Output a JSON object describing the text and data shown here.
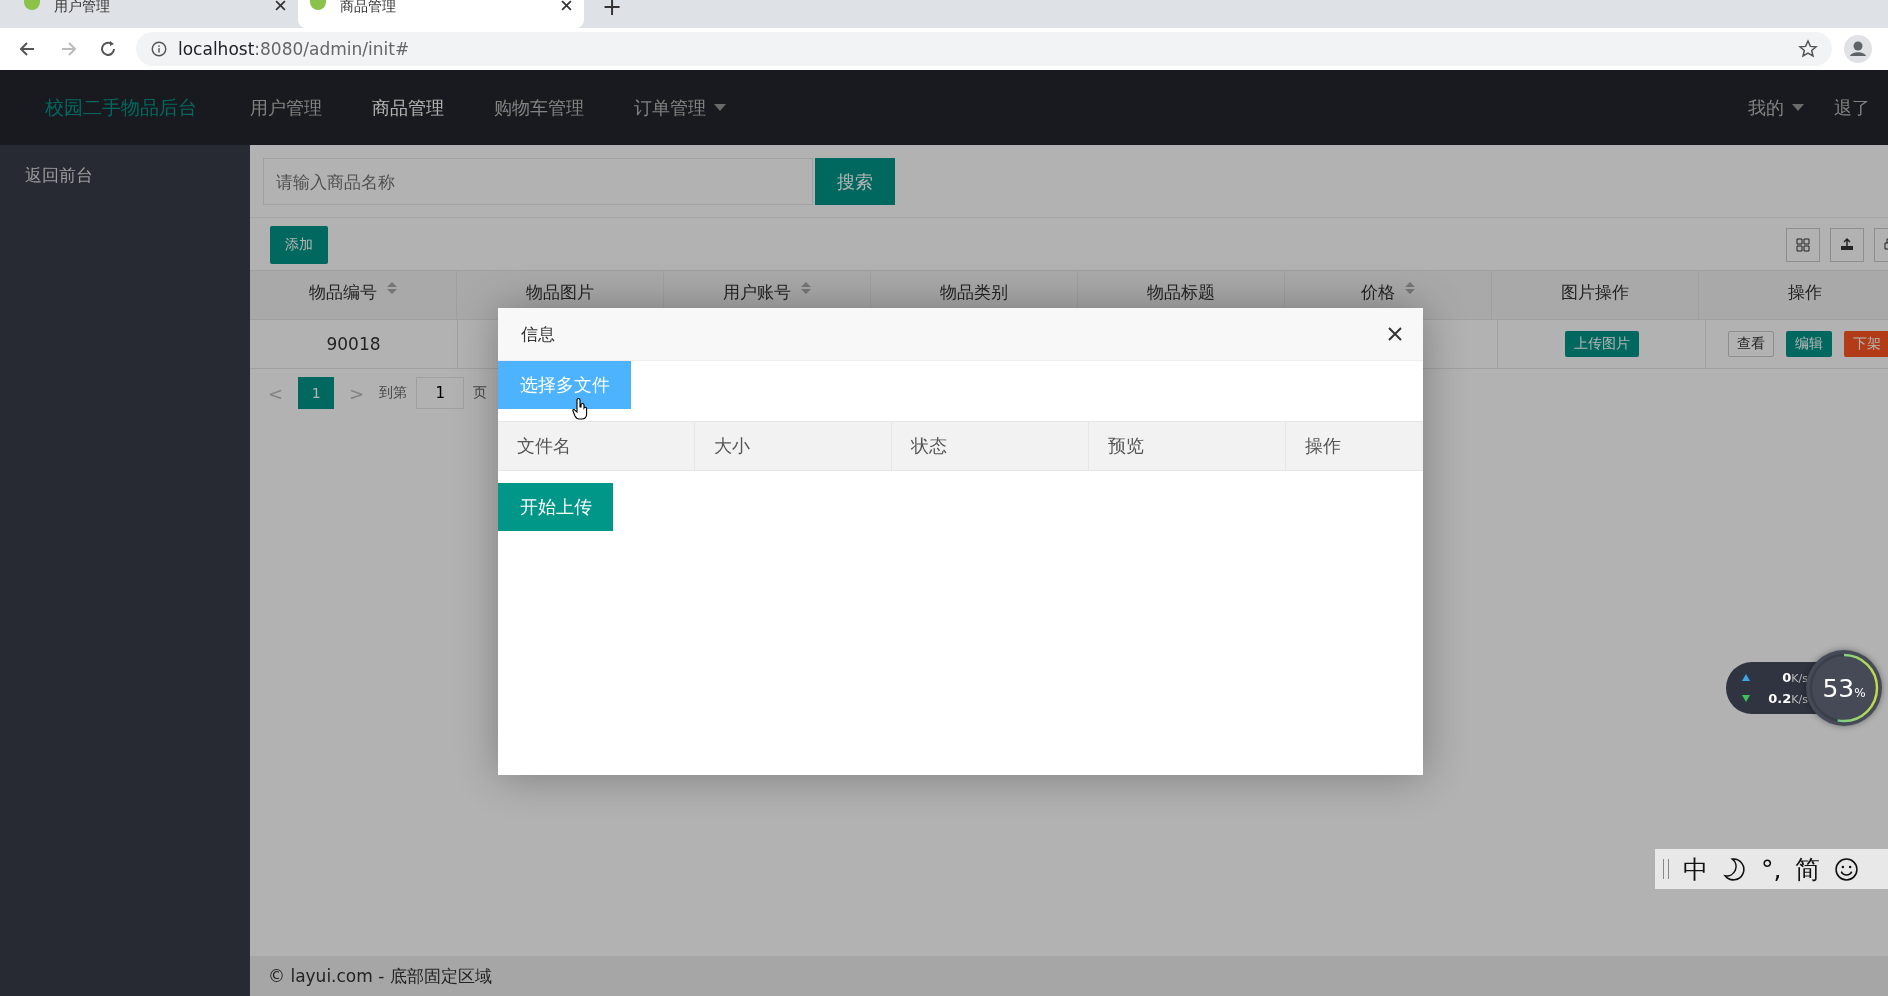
{
  "browser": {
    "tabs": [
      {
        "title": "用户管理",
        "selected": false
      },
      {
        "title": "商品管理",
        "selected": true
      }
    ],
    "new_tab": "+",
    "url_host": "localhost",
    "url_rest": ":8080/admin/init#"
  },
  "nav": {
    "logo": "校园二手物品后台",
    "items": [
      {
        "label": "用户管理",
        "selected": false,
        "dropdown": false
      },
      {
        "label": "商品管理",
        "selected": true,
        "dropdown": false
      },
      {
        "label": "购物车管理",
        "selected": false,
        "dropdown": false
      },
      {
        "label": "订单管理",
        "selected": false,
        "dropdown": true
      }
    ],
    "right": [
      {
        "label": "我的",
        "dropdown": true
      },
      {
        "label": "退了",
        "dropdown": false
      }
    ]
  },
  "sidebar": {
    "items": [
      "返回前台"
    ]
  },
  "search": {
    "placeholder": "请输入商品名称",
    "button": "搜索"
  },
  "toolbar": {
    "add": "添加"
  },
  "table": {
    "columns": [
      {
        "label": "物品编号",
        "sortable": true
      },
      {
        "label": "物品图片",
        "sortable": false
      },
      {
        "label": "用户账号",
        "sortable": true
      },
      {
        "label": "物品类别",
        "sortable": false
      },
      {
        "label": "物品标题",
        "sortable": false
      },
      {
        "label": "价格",
        "sortable": true
      },
      {
        "label": "图片操作",
        "sortable": false
      },
      {
        "label": "操作",
        "sortable": false
      }
    ],
    "rows": [
      {
        "id": "90018",
        "upload": "上传图片",
        "actions": [
          {
            "label": "查看",
            "kind": "plain"
          },
          {
            "label": "编辑",
            "kind": "primary"
          },
          {
            "label": "下架",
            "kind": "danger"
          }
        ]
      }
    ]
  },
  "pagination": {
    "prev": "<",
    "current": "1",
    "next": ">",
    "goto_label": "到第",
    "goto_value": "1",
    "page_suffix": "页"
  },
  "modal": {
    "title": "信息",
    "choose_button": "选择多文件",
    "columns": [
      "文件名",
      "大小",
      "状态",
      "预览",
      "操作"
    ],
    "start_button": "开始上传"
  },
  "net_widget": {
    "up": "0",
    "up_unit": "K/s",
    "down": "0.2",
    "down_unit": "K/s",
    "cpu": "53",
    "percent": "%",
    "level": 0.53
  },
  "ime_bar": {
    "items": [
      "中",
      "°,",
      "简"
    ]
  },
  "footer": "© layui.com - 底部固定区域"
}
